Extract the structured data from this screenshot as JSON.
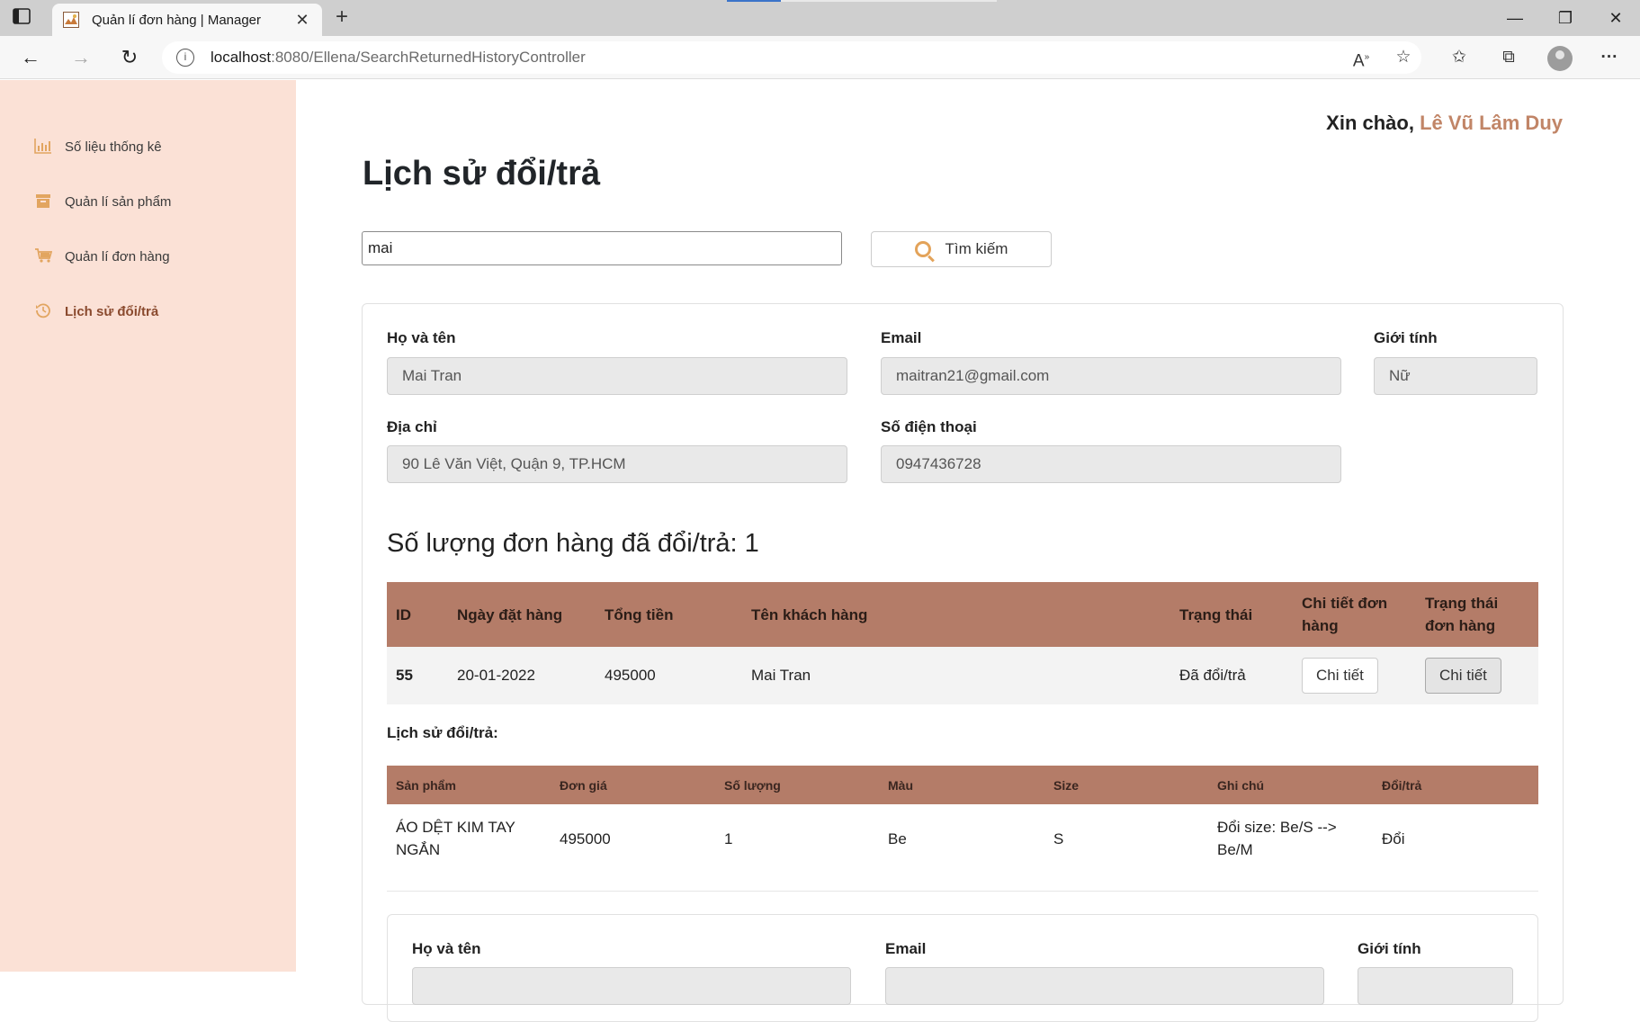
{
  "browser": {
    "tab_title": "Quản lí đơn hàng | Manager",
    "url_host": "localhost",
    "url_path": ":8080/Ellena/SearchReturnedHistoryController"
  },
  "sidebar": {
    "items": [
      {
        "label": "Số liệu thống kê",
        "icon": "bar-chart-icon"
      },
      {
        "label": "Quản lí sản phẩm",
        "icon": "archive-box-icon"
      },
      {
        "label": "Quản lí đơn hàng",
        "icon": "cart-icon"
      },
      {
        "label": "Lịch sử đổi/trả",
        "icon": "history-icon",
        "active": true
      }
    ]
  },
  "header": {
    "greeting": "Xin chào, ",
    "user_name": "Lê Vũ Lâm Duy"
  },
  "page": {
    "title": "Lịch sử đổi/trả"
  },
  "search": {
    "value": "mai",
    "button_label": "Tìm kiếm"
  },
  "customer": {
    "name_label": "Họ và tên",
    "name_value": "Mai Tran",
    "email_label": "Email",
    "email_value": "maitran21@gmail.com",
    "gender_label": "Giới tính",
    "gender_value": "Nữ",
    "address_label": "Địa chỉ",
    "address_value": "90 Lê Văn Việt, Quận 9, TP.HCM",
    "phone_label": "Số điện thoại",
    "phone_value": "0947436728"
  },
  "orders": {
    "count_title": "Số lượng đơn hàng đã đổi/trả: 1",
    "headers": [
      "ID",
      "Ngày đặt hàng",
      "Tổng tiền",
      "Tên khách hàng",
      "Trạng thái",
      "Chi tiết đơn hàng",
      "Trạng thái đơn hàng"
    ],
    "rows": [
      {
        "id": "55",
        "date": "20-01-2022",
        "total": "495000",
        "customer": "Mai Tran",
        "status": "Đã đổi/trả",
        "detail_btn": "Chi tiết",
        "status_btn": "Chi tiết"
      }
    ]
  },
  "history": {
    "label": "Lịch sử đổi/trả:",
    "headers": [
      "Sản phẩm",
      "Đơn giá",
      "Số lượng",
      "Màu",
      "Size",
      "Ghi chú",
      "Đổi/trả"
    ],
    "rows": [
      {
        "product": "ÁO DỆT KIM TAY NGẮN",
        "price": "495000",
        "qty": "1",
        "color": "Be",
        "size": "S",
        "note": "Đổi size: Be/S --> Be/M",
        "type": "Đổi"
      }
    ]
  },
  "customer2": {
    "name_label": "Họ và tên",
    "email_label": "Email",
    "gender_label": "Giới tính"
  }
}
